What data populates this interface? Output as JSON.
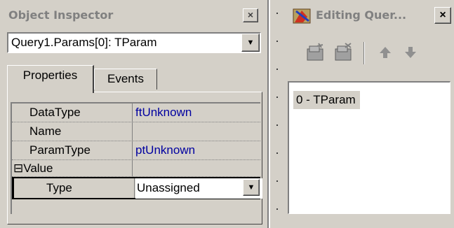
{
  "object_inspector": {
    "title": "Object Inspector",
    "close_glyph": "×",
    "selector_value": "Query1.Params[0]: TParam",
    "tabs": [
      {
        "label": "Properties"
      },
      {
        "label": "Events"
      }
    ],
    "properties": [
      {
        "name": "DataType",
        "value": "ftUnknown"
      },
      {
        "name": "Name",
        "value": ""
      },
      {
        "name": "ParamType",
        "value": "ptUnknown"
      },
      {
        "name": "Value",
        "value": "",
        "expander": "⊟"
      },
      {
        "name": "Type",
        "value": "Unassigned"
      }
    ]
  },
  "editing_query": {
    "title": "Editing Quer...",
    "close_glyph": "×",
    "toolbar": [
      "add-new-icon",
      "delete-icon",
      "move-up-icon",
      "move-down-icon"
    ],
    "items": [
      "0 - TParam"
    ]
  },
  "colors": {
    "face": "#d4d0c8",
    "value_blue": "#0000a0",
    "disabled_text": "#808080"
  }
}
